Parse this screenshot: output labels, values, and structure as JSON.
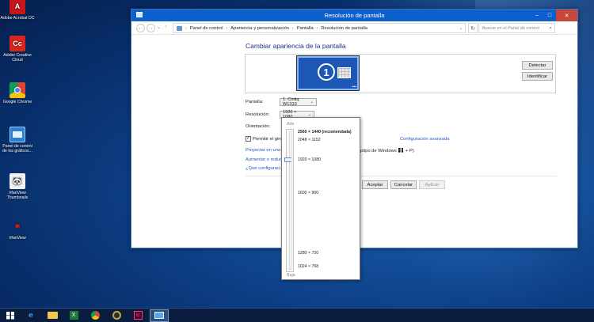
{
  "desktop": {
    "icons": [
      {
        "label": "Adobe Acrobat DC",
        "glyph": "A"
      },
      {
        "label": "Adobe Creative Cloud",
        "glyph": "Cc"
      },
      {
        "label": "Google Chrome"
      },
      {
        "label": "Panel de control de los gráficos..."
      },
      {
        "label": "IrfanView Thumbnails",
        "glyph": "🐼"
      },
      {
        "label": "IrfanView",
        "glyph": "✱"
      }
    ]
  },
  "window": {
    "title": "Resolución de pantalla",
    "controls": {
      "minimize": "–",
      "maximize": "□",
      "close": "✕"
    }
  },
  "address": {
    "back": "←",
    "forward": "→",
    "recent": "⌄",
    "up": "↑",
    "crumbs": [
      "Panel de control",
      "Apariencia y personalización",
      "Pantalla",
      "Resolución de pantalla"
    ],
    "separator": "›",
    "dropdown": "⌄",
    "refresh": "↻",
    "search_placeholder": "Buscar en el Panel de control",
    "search_glyph": "⌕"
  },
  "page": {
    "heading": "Cambiar apariencia de la pantalla",
    "monitor_number": "1",
    "detect_button": "Detectar",
    "identify_button": "Identificar",
    "display_label": "Pantalla:",
    "display_value": "1. Cintiq W1310",
    "resolution_label": "Resolución:",
    "resolution_value": "1920 × 1080",
    "orientation_label": "Orientación:",
    "rotation_checkbox_label": "Permitir el giro",
    "rotation_checked": true,
    "advanced_link": "Configuración avanzada",
    "project_link": "Proyectar en una s",
    "project_suffix": "ptipo de Windows",
    "project_key": "+ P)",
    "enlarge_link": "Aumentar o reduc",
    "which_link": "¿Qué configuraci",
    "accept_button": "Aceptar",
    "cancel_button": "Cancelar",
    "apply_button": "Aplicar"
  },
  "resolution_popup": {
    "high_label": "Alta",
    "low_label": "Baja",
    "options": [
      {
        "label": "2560 × 1440 (recomendada)",
        "bold": true
      },
      {
        "label": "2048 × 1152",
        "bold": false
      },
      {
        "label": "1920 × 1080",
        "bold": false
      },
      {
        "label": "1600 × 900",
        "bold": false
      },
      {
        "label": "1280 × 720",
        "bold": false
      },
      {
        "label": "1024 × 768",
        "bold": false
      }
    ],
    "selected": "1920 × 1080"
  },
  "taskbar": {
    "ie_glyph": "e",
    "excel_glyph": "X",
    "indesign_glyph": "Id"
  }
}
